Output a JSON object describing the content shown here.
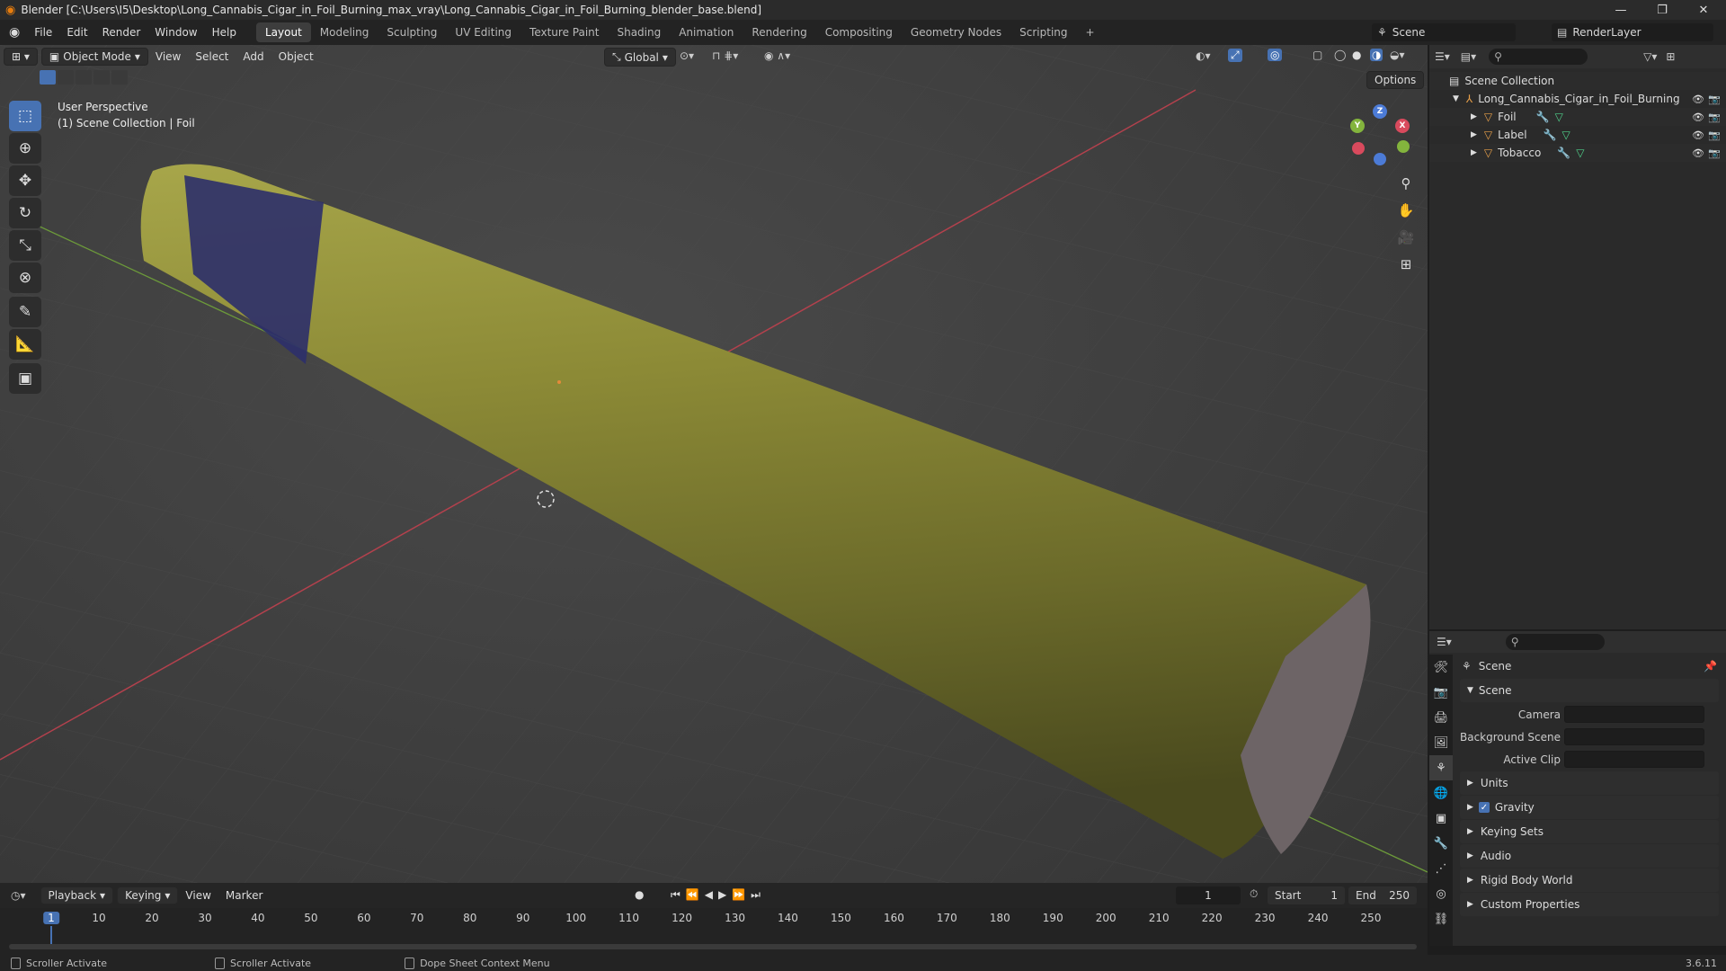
{
  "window": {
    "title": "Blender [C:\\Users\\I5\\Desktop\\Long_Cannabis_Cigar_in_Foil_Burning_max_vray\\Long_Cannabis_Cigar_in_Foil_Burning_blender_base.blend]",
    "minimize": "—",
    "maximize": "❐",
    "close": "✕"
  },
  "menu": {
    "file": "File",
    "edit": "Edit",
    "render": "Render",
    "window": "Window",
    "help": "Help"
  },
  "workspaces": [
    "Layout",
    "Modeling",
    "Sculpting",
    "UV Editing",
    "Texture Paint",
    "Shading",
    "Animation",
    "Rendering",
    "Compositing",
    "Geometry Nodes",
    "Scripting"
  ],
  "topright": {
    "scene": "Scene",
    "renderlayer": "RenderLayer"
  },
  "viewport": {
    "mode": "Object Mode",
    "view": "View",
    "select": "Select",
    "add": "Add",
    "object": "Object",
    "orientation": "Global",
    "options": "Options",
    "overlay1": "User Perspective",
    "overlay2": "(1) Scene Collection | Foil"
  },
  "gizmo": {
    "x": "X",
    "y": "Y",
    "z": "Z"
  },
  "outliner": {
    "root": "Scene Collection",
    "collection": "Long_Cannabis_Cigar_in_Foil_Burning",
    "items": [
      "Foil",
      "Label",
      "Tobacco"
    ]
  },
  "properties": {
    "header": "Scene",
    "section": "Scene",
    "camera": "Camera",
    "bgscene": "Background Scene",
    "clip": "Active Clip",
    "panels": [
      "Units",
      "Gravity",
      "Keying Sets",
      "Audio",
      "Rigid Body World",
      "Custom Properties"
    ]
  },
  "timeline": {
    "playback": "Playback",
    "keying": "Keying",
    "view": "View",
    "marker": "Marker",
    "frame": "1",
    "start_label": "Start",
    "start": "1",
    "end_label": "End",
    "end": "250",
    "ticks": [
      "1",
      "10",
      "20",
      "30",
      "40",
      "50",
      "60",
      "70",
      "80",
      "90",
      "100",
      "110",
      "120",
      "130",
      "140",
      "150",
      "160",
      "170",
      "180",
      "190",
      "200",
      "210",
      "220",
      "230",
      "240",
      "250"
    ]
  },
  "status": {
    "a": "Scroller Activate",
    "b": "Scroller Activate",
    "c": "Dope Sheet Context Menu",
    "version": "3.6.11"
  }
}
